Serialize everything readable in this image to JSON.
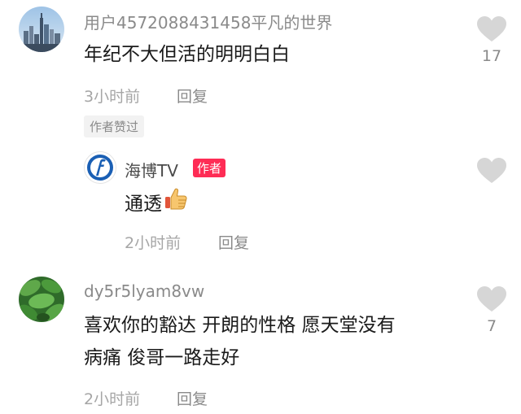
{
  "comments": [
    {
      "username": "用户4572088431458平凡的世界",
      "text": "年纪不大但活的明明白白",
      "time": "3小时前",
      "reply_label": "回复",
      "author_liked_tag": "作者赞过",
      "like_count": "17",
      "avatar_icon": "city-skyline-avatar",
      "replies": [
        {
          "username": "海博TV",
          "author_badge": "作者",
          "text": "通透",
          "emoji_icon": "thumbs-up-icon",
          "time": "2小时前",
          "reply_label": "回复",
          "avatar_icon": "haibo-tv-logo-avatar"
        }
      ]
    },
    {
      "username": "dy5r5lyam8vw",
      "text_line1": "喜欢你的豁达 开朗的性格 愿天堂没有",
      "text_line2": "病痛 俊哥一路走好",
      "time": "2小时前",
      "reply_label": "回复",
      "like_count": "7",
      "avatar_icon": "green-leaves-avatar"
    }
  ],
  "colors": {
    "username": "#8a8a8a",
    "text": "#1a1a1a",
    "muted": "#a6a6a6",
    "heart": "#d6d6d6",
    "author_badge": "#fe2c55",
    "logo_blue": "#1a5fb4"
  }
}
